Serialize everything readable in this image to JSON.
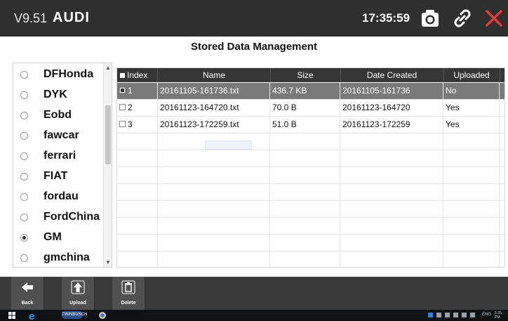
{
  "header": {
    "version": "V9.51",
    "brand": "AUDI",
    "time": "17:35:59",
    "icons": [
      "camera-icon",
      "link-icon",
      "close-icon"
    ],
    "accent_close": "#e53935"
  },
  "page_title": "Stored Data Management",
  "vehicle_list": {
    "items": [
      {
        "label": "DFHonda",
        "selected": false
      },
      {
        "label": "DYK",
        "selected": false
      },
      {
        "label": "Eobd",
        "selected": false
      },
      {
        "label": "fawcar",
        "selected": false
      },
      {
        "label": "ferrari",
        "selected": false
      },
      {
        "label": "FIAT",
        "selected": false
      },
      {
        "label": "fordau",
        "selected": false
      },
      {
        "label": "FordChina",
        "selected": false
      },
      {
        "label": "GM",
        "selected": true
      },
      {
        "label": "gmchina",
        "selected": false
      }
    ]
  },
  "table": {
    "columns": {
      "index": "Index",
      "name": "Name",
      "size": "Size",
      "date": "Date Created",
      "uploaded": "Uploaded"
    },
    "rows": [
      {
        "index": "1",
        "name": "20161105-161736.txt",
        "size": "436.7 KB",
        "date": "20161105-161736",
        "uploaded": "No",
        "checked": true,
        "selected": true
      },
      {
        "index": "2",
        "name": "20161123-164720.txt",
        "size": "70.0 B",
        "date": "20161123-164720",
        "uploaded": "Yes",
        "checked": false,
        "selected": false
      },
      {
        "index": "3",
        "name": "20161123-172259.txt",
        "size": "51.0 B",
        "date": "20161123-172259",
        "uploaded": "Yes",
        "checked": false,
        "selected": false
      }
    ]
  },
  "toolbar": {
    "back_label": "Back",
    "upload_label": "Upload",
    "delete_label": "Delete"
  },
  "taskbar": {
    "app_label": "TWINBUSCH",
    "lang": "ENG",
    "clock": "5:35 PM"
  }
}
